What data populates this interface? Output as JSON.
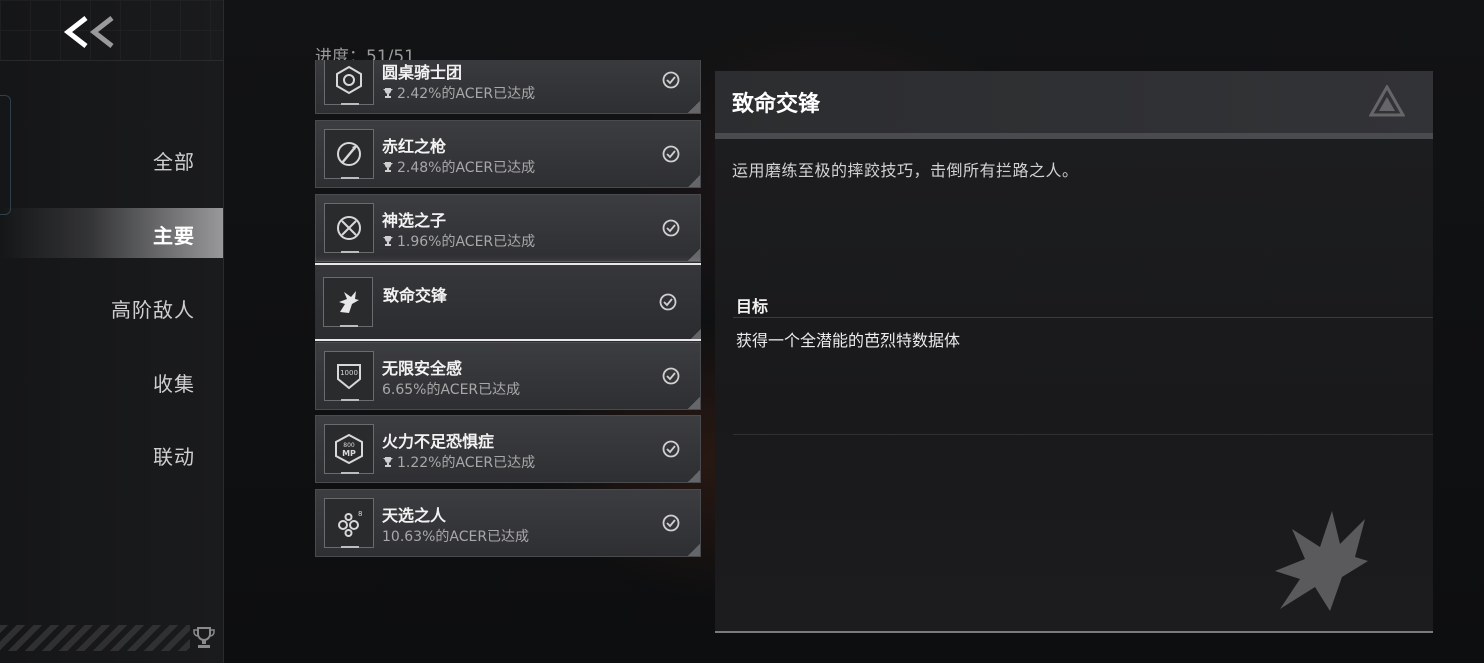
{
  "sidebar": {
    "back_label": "<<",
    "items": [
      {
        "label": "全部",
        "active": false
      },
      {
        "label": "主要",
        "active": true
      },
      {
        "label": "高阶敌人",
        "active": false
      },
      {
        "label": "收集",
        "active": false
      },
      {
        "label": "联动",
        "active": false
      }
    ]
  },
  "progress": {
    "text": "进度：51/51"
  },
  "achievements": [
    {
      "title": "圆桌骑士团",
      "rate": "2.42%的ACER已达成",
      "icon": "shield-emblem-icon",
      "completed": true,
      "trophy": true
    },
    {
      "title": "赤红之枪",
      "rate": "2.48%的ACER已达成",
      "icon": "spear-icon",
      "completed": true,
      "trophy": true
    },
    {
      "title": "神选之子",
      "rate": "1.96%的ACER已达成",
      "icon": "crossed-swords-icon",
      "completed": true,
      "trophy": true
    },
    {
      "title": "致命交锋",
      "rate": "",
      "icon": "phoenix-icon",
      "completed": true,
      "trophy": false,
      "selected": true
    },
    {
      "title": "无限安全感",
      "rate": "6.65%的ACER已达成",
      "icon": "armor-1000-icon",
      "completed": true,
      "trophy": false
    },
    {
      "title": "火力不足恐惧症",
      "rate": "1.22%的ACER已达成",
      "icon": "mp-800-icon",
      "completed": true,
      "trophy": true
    },
    {
      "title": "天选之人",
      "rate": "10.63%的ACER已达成",
      "icon": "gears-icon",
      "completed": true,
      "trophy": false
    }
  ],
  "detail": {
    "title": "致命交锋",
    "description": "运用磨练至极的摔跤技巧，击倒所有拦路之人。",
    "goal_label": "目标",
    "goal_text": "获得一个全潜能的芭烈特数据体"
  },
  "colors": {
    "background": "#0f1012",
    "card": "#36373a",
    "selected_border": "#e8e8e8"
  }
}
